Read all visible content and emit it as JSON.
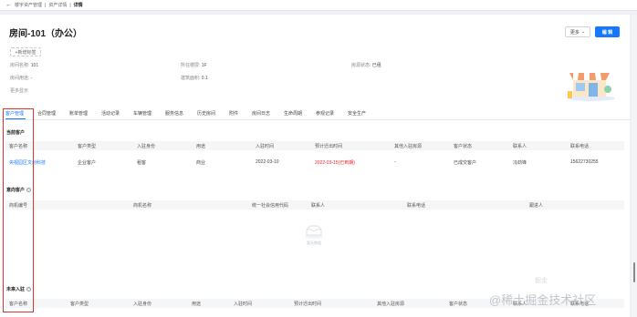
{
  "breadcrumb": {
    "items": [
      "楼宇资产管理",
      "资产详情"
    ],
    "current": "详情"
  },
  "header": {
    "title": "房间-101（办公）",
    "more_label": "更多",
    "edit_label": "编 辑",
    "add_tag_label": "+新增标签"
  },
  "info": {
    "room_name_label": "房间名称:",
    "room_name": "101",
    "floor_label": "所在楼层:",
    "floor": "1F",
    "status_label": "房源状态:",
    "status": "已租",
    "usage_label": "房间用途:",
    "usage": "-",
    "area_label": "建筑面积:",
    "area": "0.1",
    "expand_label": "更多显示"
  },
  "tabs": [
    "客户管理",
    "合同管理",
    "账单管理",
    "活动记录",
    "车辆管理",
    "服务信息",
    "历史房间",
    "附件",
    "房间日志",
    "生命周期",
    "参观记录",
    "安全生产"
  ],
  "sections": {
    "current": {
      "title": "当前客户"
    },
    "intent": {
      "title": "意向客户"
    },
    "future": {
      "title": "未来入驻"
    }
  },
  "current_table": {
    "columns": [
      "客户名称",
      "客户类型",
      "入驻身份",
      "用途",
      "入驻时间",
      "预计迁出时间",
      "其他入驻房源",
      "客户状态",
      "联系人",
      "联系电话"
    ],
    "rows": [
      [
        "央视园区文创科技",
        "企业客户",
        "租客",
        "商业",
        "2022-03-10",
        "2022-03-15(已到期)",
        "-",
        "已成交客户",
        "冯劲锋",
        "15622730255"
      ]
    ]
  },
  "intent_table": {
    "columns": [
      "商机编号",
      "商机名称",
      "统一社会信用代码",
      "联系人",
      "联系电话",
      "跟进人"
    ],
    "empty_text": "暂无数据"
  },
  "future_table": {
    "columns": [
      "客户名称",
      "客户类型",
      "入驻身份",
      "用途",
      "入驻时间",
      "预计迁出时间",
      "其他入驻房源",
      "客户状态",
      "联系人",
      "联系电话"
    ]
  },
  "watermark": {
    "text": "@稀土掘金技术社区",
    "faint_text": "掘金"
  },
  "colors": {
    "accent": "#1677ff",
    "danger": "#f5222d",
    "highlight": "#e0312b"
  }
}
